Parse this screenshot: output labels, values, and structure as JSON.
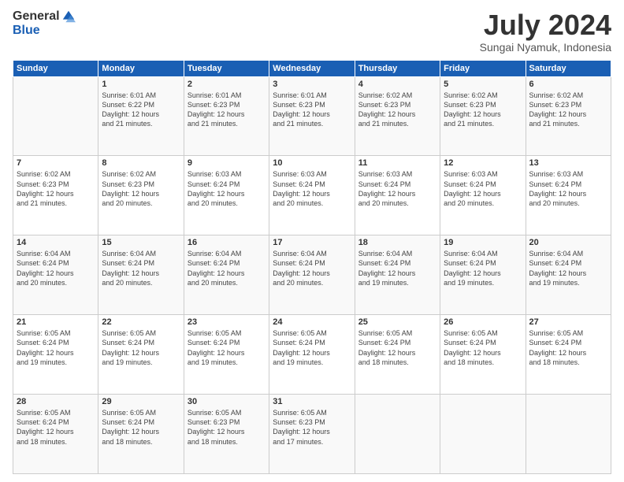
{
  "logo": {
    "general": "General",
    "blue": "Blue"
  },
  "title": "July 2024",
  "subtitle": "Sungai Nyamuk, Indonesia",
  "days": [
    "Sunday",
    "Monday",
    "Tuesday",
    "Wednesday",
    "Thursday",
    "Friday",
    "Saturday"
  ],
  "weeks": [
    [
      {
        "num": "",
        "text": ""
      },
      {
        "num": "1",
        "text": "Sunrise: 6:01 AM\nSunset: 6:22 PM\nDaylight: 12 hours\nand 21 minutes."
      },
      {
        "num": "2",
        "text": "Sunrise: 6:01 AM\nSunset: 6:23 PM\nDaylight: 12 hours\nand 21 minutes."
      },
      {
        "num": "3",
        "text": "Sunrise: 6:01 AM\nSunset: 6:23 PM\nDaylight: 12 hours\nand 21 minutes."
      },
      {
        "num": "4",
        "text": "Sunrise: 6:02 AM\nSunset: 6:23 PM\nDaylight: 12 hours\nand 21 minutes."
      },
      {
        "num": "5",
        "text": "Sunrise: 6:02 AM\nSunset: 6:23 PM\nDaylight: 12 hours\nand 21 minutes."
      },
      {
        "num": "6",
        "text": "Sunrise: 6:02 AM\nSunset: 6:23 PM\nDaylight: 12 hours\nand 21 minutes."
      }
    ],
    [
      {
        "num": "7",
        "text": "Sunrise: 6:02 AM\nSunset: 6:23 PM\nDaylight: 12 hours\nand 21 minutes."
      },
      {
        "num": "8",
        "text": "Sunrise: 6:02 AM\nSunset: 6:23 PM\nDaylight: 12 hours\nand 20 minutes."
      },
      {
        "num": "9",
        "text": "Sunrise: 6:03 AM\nSunset: 6:24 PM\nDaylight: 12 hours\nand 20 minutes."
      },
      {
        "num": "10",
        "text": "Sunrise: 6:03 AM\nSunset: 6:24 PM\nDaylight: 12 hours\nand 20 minutes."
      },
      {
        "num": "11",
        "text": "Sunrise: 6:03 AM\nSunset: 6:24 PM\nDaylight: 12 hours\nand 20 minutes."
      },
      {
        "num": "12",
        "text": "Sunrise: 6:03 AM\nSunset: 6:24 PM\nDaylight: 12 hours\nand 20 minutes."
      },
      {
        "num": "13",
        "text": "Sunrise: 6:03 AM\nSunset: 6:24 PM\nDaylight: 12 hours\nand 20 minutes."
      }
    ],
    [
      {
        "num": "14",
        "text": "Sunrise: 6:04 AM\nSunset: 6:24 PM\nDaylight: 12 hours\nand 20 minutes."
      },
      {
        "num": "15",
        "text": "Sunrise: 6:04 AM\nSunset: 6:24 PM\nDaylight: 12 hours\nand 20 minutes."
      },
      {
        "num": "16",
        "text": "Sunrise: 6:04 AM\nSunset: 6:24 PM\nDaylight: 12 hours\nand 20 minutes."
      },
      {
        "num": "17",
        "text": "Sunrise: 6:04 AM\nSunset: 6:24 PM\nDaylight: 12 hours\nand 20 minutes."
      },
      {
        "num": "18",
        "text": "Sunrise: 6:04 AM\nSunset: 6:24 PM\nDaylight: 12 hours\nand 19 minutes."
      },
      {
        "num": "19",
        "text": "Sunrise: 6:04 AM\nSunset: 6:24 PM\nDaylight: 12 hours\nand 19 minutes."
      },
      {
        "num": "20",
        "text": "Sunrise: 6:04 AM\nSunset: 6:24 PM\nDaylight: 12 hours\nand 19 minutes."
      }
    ],
    [
      {
        "num": "21",
        "text": "Sunrise: 6:05 AM\nSunset: 6:24 PM\nDaylight: 12 hours\nand 19 minutes."
      },
      {
        "num": "22",
        "text": "Sunrise: 6:05 AM\nSunset: 6:24 PM\nDaylight: 12 hours\nand 19 minutes."
      },
      {
        "num": "23",
        "text": "Sunrise: 6:05 AM\nSunset: 6:24 PM\nDaylight: 12 hours\nand 19 minutes."
      },
      {
        "num": "24",
        "text": "Sunrise: 6:05 AM\nSunset: 6:24 PM\nDaylight: 12 hours\nand 19 minutes."
      },
      {
        "num": "25",
        "text": "Sunrise: 6:05 AM\nSunset: 6:24 PM\nDaylight: 12 hours\nand 18 minutes."
      },
      {
        "num": "26",
        "text": "Sunrise: 6:05 AM\nSunset: 6:24 PM\nDaylight: 12 hours\nand 18 minutes."
      },
      {
        "num": "27",
        "text": "Sunrise: 6:05 AM\nSunset: 6:24 PM\nDaylight: 12 hours\nand 18 minutes."
      }
    ],
    [
      {
        "num": "28",
        "text": "Sunrise: 6:05 AM\nSunset: 6:24 PM\nDaylight: 12 hours\nand 18 minutes."
      },
      {
        "num": "29",
        "text": "Sunrise: 6:05 AM\nSunset: 6:24 PM\nDaylight: 12 hours\nand 18 minutes."
      },
      {
        "num": "30",
        "text": "Sunrise: 6:05 AM\nSunset: 6:23 PM\nDaylight: 12 hours\nand 18 minutes."
      },
      {
        "num": "31",
        "text": "Sunrise: 6:05 AM\nSunset: 6:23 PM\nDaylight: 12 hours\nand 17 minutes."
      },
      {
        "num": "",
        "text": ""
      },
      {
        "num": "",
        "text": ""
      },
      {
        "num": "",
        "text": ""
      }
    ]
  ]
}
